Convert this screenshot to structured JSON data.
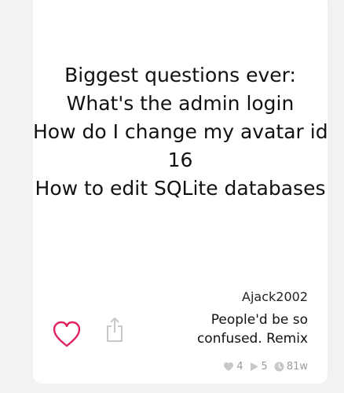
{
  "post": {
    "lines": [
      "Biggest questions ever:",
      "What's the admin login",
      "How do I change my avatar id to",
      "16",
      "How to edit SQLite databases"
    ]
  },
  "author": {
    "username": "Ajack2002"
  },
  "caption": "People'd be so confused. Remix",
  "stats": {
    "likes": "4",
    "plays": "5",
    "age": "81w"
  },
  "colors": {
    "heart": "#e0245e",
    "muted": "#c8c8c8"
  },
  "icons": {
    "like": "heart-icon",
    "share": "share-icon"
  }
}
